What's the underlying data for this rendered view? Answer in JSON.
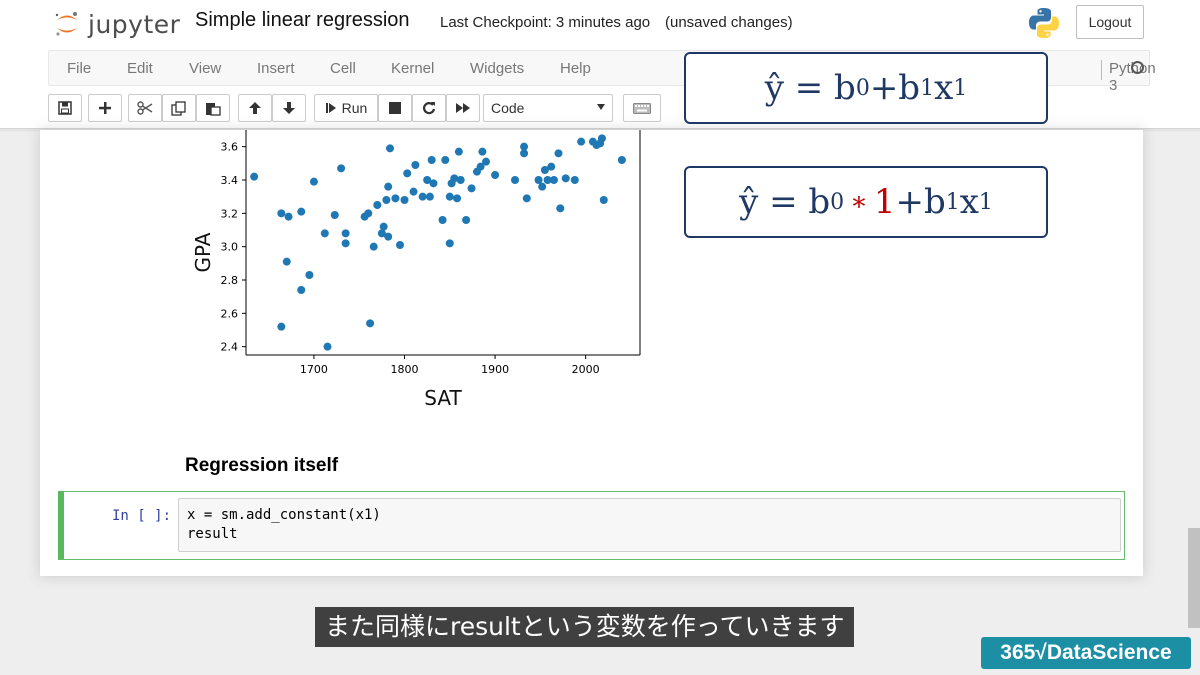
{
  "header": {
    "logo_text": "jupyter",
    "notebook_title": "Simple linear regression",
    "checkpoint": "Last Checkpoint: 3 minutes ago",
    "status": "(unsaved changes)",
    "logout_label": "Logout"
  },
  "menu": {
    "items": [
      "File",
      "Edit",
      "View",
      "Insert",
      "Cell",
      "Kernel",
      "Widgets",
      "Help"
    ],
    "kernel": "Python 3"
  },
  "toolbar": {
    "run_label": "Run",
    "cell_type": "Code"
  },
  "cells": {
    "heading": "Regression itself",
    "prompt": "In [ ]:",
    "code": "x = sm.add_constant(x1)\nresult"
  },
  "formulas": {
    "f1": {
      "lhs": "ŷ = b",
      "sub0": "0",
      "plus": "+b",
      "sub1a": "1",
      "x": "x",
      "sub1b": "1"
    },
    "f2": {
      "lhs": "ŷ = b",
      "sub0": "0",
      "star": "∗",
      "one": "1",
      "plus": "+b",
      "sub1a": "1",
      "x": "x",
      "sub1b": "1"
    }
  },
  "subtitle": "また同様にresultという変数を作っていきます",
  "brand": "365√DataScience",
  "colors": {
    "accent": "#1f77b4",
    "cell_border": "#5cb85c",
    "formula": "#1f3864",
    "highlight": "#c00000"
  },
  "chart_data": {
    "type": "scatter",
    "xlabel": "SAT",
    "ylabel": "GPA",
    "x_ticks": [
      "1700",
      "1800",
      "1900",
      "2000"
    ],
    "y_ticks": [
      "2.4",
      "2.6",
      "2.8",
      "3.0",
      "3.2",
      "3.4",
      "3.6"
    ],
    "xlim": [
      1625,
      2060
    ],
    "ylim": [
      2.35,
      3.7
    ],
    "points": [
      [
        1634,
        3.42
      ],
      [
        1664,
        3.2
      ],
      [
        1664,
        2.52
      ],
      [
        1672,
        3.18
      ],
      [
        1670,
        2.91
      ],
      [
        1686,
        3.21
      ],
      [
        1686,
        2.74
      ],
      [
        1695,
        2.83
      ],
      [
        1700,
        3.39
      ],
      [
        1712,
        3.08
      ],
      [
        1715,
        2.4
      ],
      [
        1723,
        3.19
      ],
      [
        1730,
        3.47
      ],
      [
        1735,
        3.08
      ],
      [
        1735,
        3.02
      ],
      [
        1756,
        3.18
      ],
      [
        1760,
        3.2
      ],
      [
        1762,
        2.54
      ],
      [
        1766,
        3.0
      ],
      [
        1770,
        3.25
      ],
      [
        1775,
        3.08
      ],
      [
        1777,
        3.12
      ],
      [
        1780,
        3.28
      ],
      [
        1782,
        3.36
      ],
      [
        1782,
        3.06
      ],
      [
        1784,
        3.59
      ],
      [
        1790,
        3.29
      ],
      [
        1795,
        3.01
      ],
      [
        1800,
        3.28
      ],
      [
        1803,
        3.44
      ],
      [
        1808,
        3.7
      ],
      [
        1810,
        3.33
      ],
      [
        1812,
        3.49
      ],
      [
        1820,
        3.3
      ],
      [
        1825,
        3.4
      ],
      [
        1828,
        3.3
      ],
      [
        1830,
        3.52
      ],
      [
        1832,
        3.38
      ],
      [
        1840,
        3.7
      ],
      [
        1842,
        3.16
      ],
      [
        1845,
        3.52
      ],
      [
        1850,
        3.02
      ],
      [
        1850,
        3.3
      ],
      [
        1852,
        3.38
      ],
      [
        1855,
        3.41
      ],
      [
        1858,
        3.29
      ],
      [
        1860,
        3.57
      ],
      [
        1862,
        3.4
      ],
      [
        1868,
        3.16
      ],
      [
        1874,
        3.35
      ],
      [
        1880,
        3.45
      ],
      [
        1884,
        3.48
      ],
      [
        1886,
        3.57
      ],
      [
        1890,
        3.51
      ],
      [
        1900,
        3.43
      ],
      [
        1922,
        3.4
      ],
      [
        1932,
        3.56
      ],
      [
        1935,
        3.29
      ],
      [
        1932,
        3.6
      ],
      [
        1935,
        3.7
      ],
      [
        1948,
        3.4
      ],
      [
        1952,
        3.36
      ],
      [
        1955,
        3.46
      ],
      [
        1958,
        3.4
      ],
      [
        1962,
        3.48
      ],
      [
        1965,
        3.4
      ],
      [
        1970,
        3.56
      ],
      [
        1972,
        3.23
      ],
      [
        1978,
        3.41
      ],
      [
        1984,
        3.7
      ],
      [
        1988,
        3.4
      ],
      [
        1995,
        3.63
      ],
      [
        2008,
        3.63
      ],
      [
        2012,
        3.61
      ],
      [
        2016,
        3.62
      ],
      [
        2018,
        3.65
      ],
      [
        2020,
        3.28
      ],
      [
        2040,
        3.52
      ]
    ]
  }
}
